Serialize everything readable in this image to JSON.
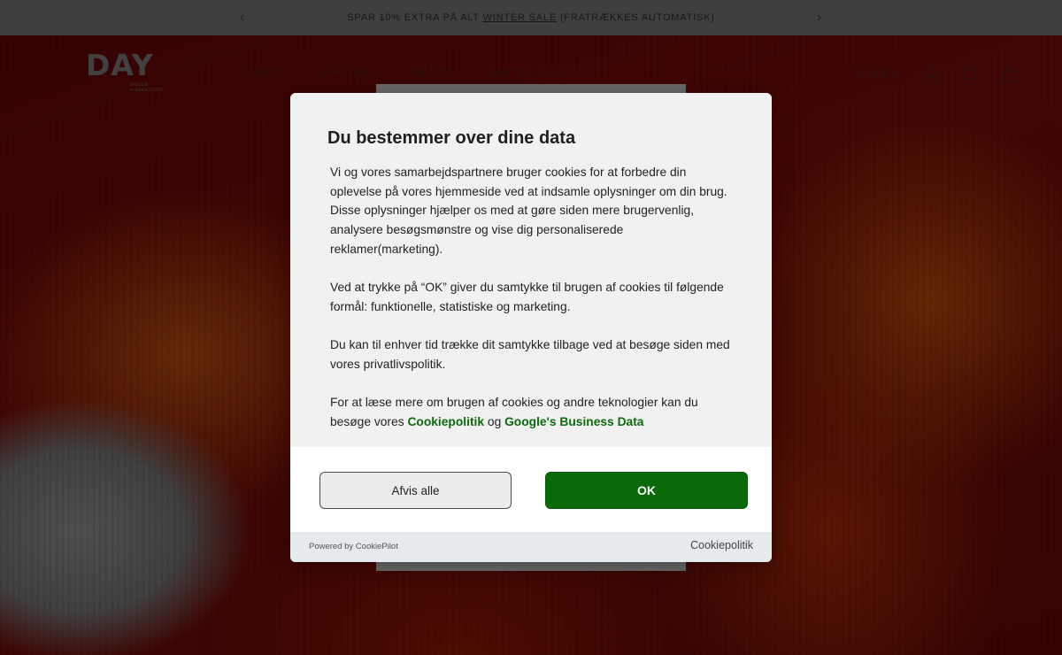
{
  "announcement": {
    "prefix": "SPAR 10% EXTRA PÅ ALT ",
    "link": "WINTER SALE",
    "suffix": " (FRATRÆKKES AUTOMATISK)"
  },
  "brand": {
    "logo": "DAY",
    "logo_sub_line1": "BIRGER",
    "logo_sub_line2": "et MIKKELSEN"
  },
  "nav": {
    "items": [
      "SHOP",
      "NYHEDER",
      "2NDDAY",
      "WINTER SALE"
    ]
  },
  "header": {
    "locale": "DK/DKK",
    "icons": [
      "account-icon",
      "search-icon",
      "bag-icon"
    ]
  },
  "consent": {
    "title": "Du bestemmer over dine data",
    "p1": "Vi og vores samarbejdspartnere bruger cookies for at forbedre din oplevelse på vores hjemmeside ved at indsamle oplysninger om din brug. Disse oplysninger hjælper os med at gøre siden mere brugervenlig, analysere besøgsmønstre og vise dig personaliserede reklamer(marketing).",
    "p2": "Ved at trykke på “OK” giver du samtykke til brugen af cookies til følgende formål: funktionelle, statistiske og marketing.",
    "p3": "Du kan til enhver tid trække dit samtykke tilbage ved at besøge siden med vores privatlivspolitik.",
    "p4_prefix": "For at læse mere om brugen af cookies og andre teknologier kan du besøge vores ",
    "p4_link1": "Cookiepolitik",
    "p4_mid": " og ",
    "p4_link2": "Google's Business Data",
    "reject_label": "Afvis alle",
    "ok_label": "OK",
    "powered_by": "Powered by CookiePilot",
    "footer_link": "Cookiepolitik"
  },
  "colors": {
    "accent_green": "#0a6a0a",
    "link_green": "#0b6b0b"
  }
}
